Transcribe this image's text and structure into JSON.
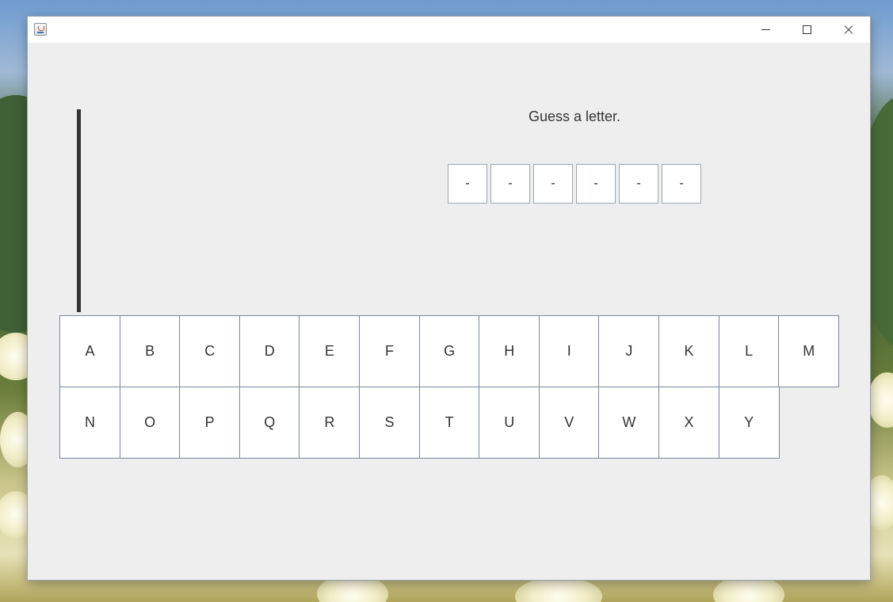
{
  "window": {
    "title": ""
  },
  "game": {
    "prompt": "Guess a letter.",
    "word_slots": [
      "-",
      "-",
      "-",
      "-",
      "-",
      "-"
    ]
  },
  "keyboard": {
    "row1": [
      "A",
      "B",
      "C",
      "D",
      "E",
      "F",
      "G",
      "H",
      "I",
      "J",
      "K",
      "L",
      "M"
    ],
    "row2": [
      "N",
      "O",
      "P",
      "Q",
      "R",
      "S",
      "T",
      "U",
      "V",
      "W",
      "X",
      "Y"
    ]
  },
  "icons": {
    "app": "java-cup-icon",
    "minimize": "minimize-icon",
    "maximize": "maximize-icon",
    "close": "close-icon"
  }
}
